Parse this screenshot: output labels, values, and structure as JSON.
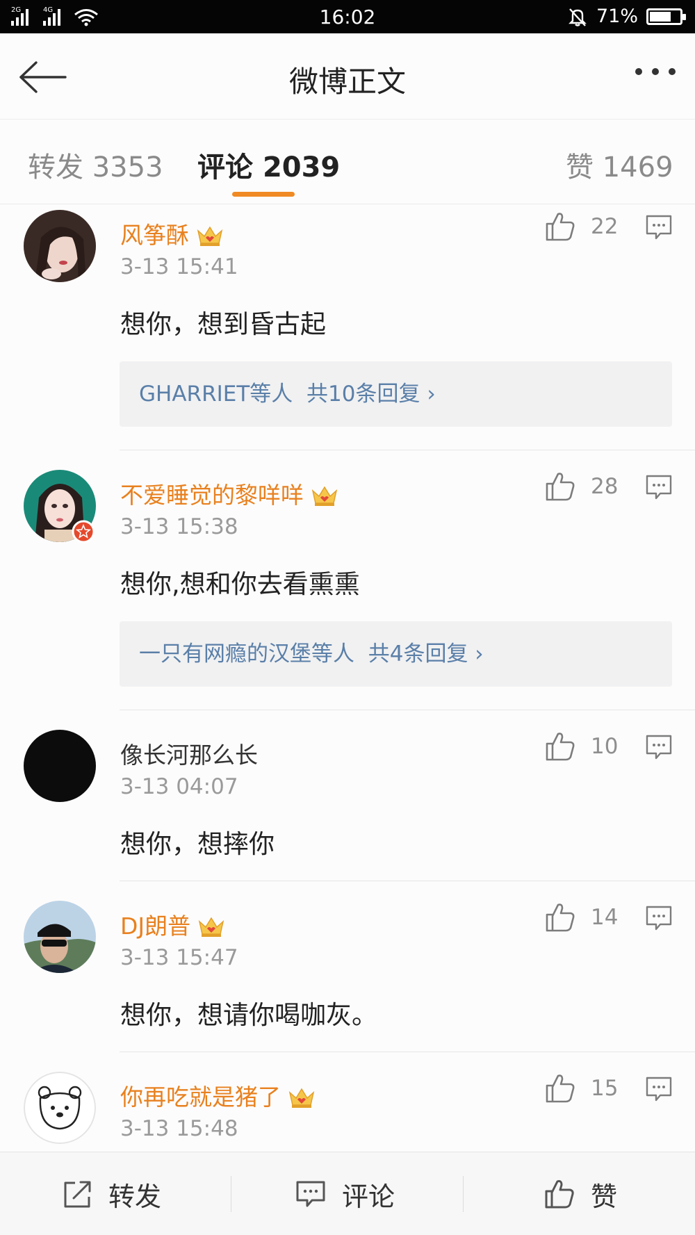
{
  "status_bar": {
    "signal_1": "2G",
    "signal_2": "4G",
    "time": "16:02",
    "battery": "71%",
    "battery_level": 0.71,
    "icons": [
      "signal-icon",
      "wifi-icon",
      "mute-bell-icon",
      "battery-icon"
    ]
  },
  "nav": {
    "title": "微博正文",
    "back_icon": "back-arrow-icon",
    "more_icon": "more-dots-icon"
  },
  "tabs": [
    {
      "label": "转发",
      "count": "3353",
      "active": false
    },
    {
      "label": "评论",
      "count": "2039",
      "active": true
    },
    {
      "label": "赞",
      "count": "1469",
      "active": false
    }
  ],
  "accent_color": "#f08a24",
  "name_color": "#e8811f",
  "link_color": "#5a7fa8",
  "comments": [
    {
      "name": "风筝酥",
      "vip": true,
      "time": "3-13 15:41",
      "text": "想你，想到昏古起",
      "likes": "22",
      "replies": {
        "users": "GHARRIET等人",
        "summary": "共10条回复 ›"
      }
    },
    {
      "name": "不爱睡觉的黎咩咩",
      "vip": true,
      "time": "3-13 15:38",
      "text": "想你,想和你去看熏熏",
      "likes": "28",
      "replies": {
        "users": "一只有网瘾的汉堡等人",
        "summary": "共4条回复 ›"
      }
    },
    {
      "name": "像长河那么长",
      "vip": false,
      "time": "3-13 04:07",
      "text": "想你，想摔你",
      "likes": "10"
    },
    {
      "name": "DJ朗普",
      "vip": true,
      "time": "3-13 15:47",
      "text": "想你，想请你喝咖灰。",
      "likes": "14"
    },
    {
      "name": "你再吃就是猪了",
      "vip": true,
      "time": "3-13 15:48",
      "text": "",
      "likes": "15"
    }
  ],
  "bottom_bar": [
    {
      "label": "转发",
      "icon": "share-icon"
    },
    {
      "label": "评论",
      "icon": "comment-icon"
    },
    {
      "label": "赞",
      "icon": "thumbs-up-icon"
    }
  ]
}
